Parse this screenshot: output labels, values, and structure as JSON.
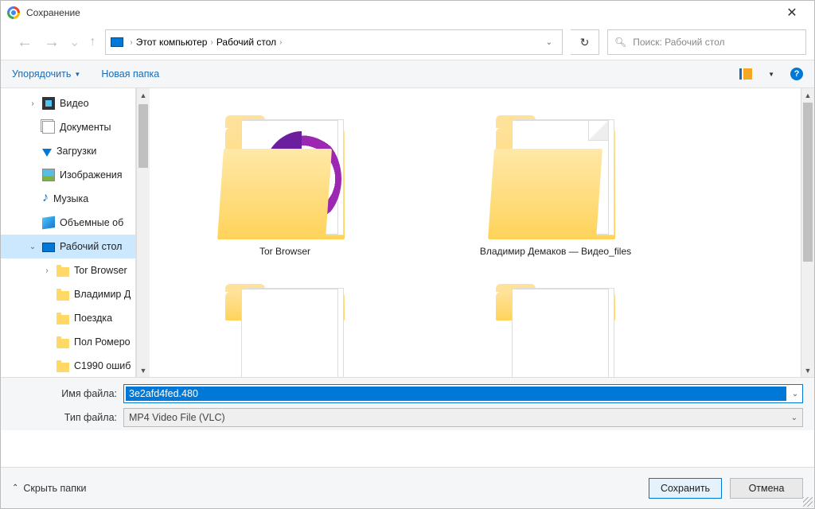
{
  "window": {
    "title": "Сохранение"
  },
  "nav": {
    "breadcrumb": {
      "root": "Этот компьютер",
      "current": "Рабочий стол"
    },
    "search_placeholder": "Поиск: Рабочий стол"
  },
  "toolbar": {
    "arrange": "Упорядочить",
    "new_folder": "Новая папка"
  },
  "sidebar": {
    "items": [
      {
        "label": "Видео",
        "icon": "video",
        "level": 2,
        "exp": ">"
      },
      {
        "label": "Документы",
        "icon": "docs",
        "level": 2
      },
      {
        "label": "Загрузки",
        "icon": "dl",
        "level": 2
      },
      {
        "label": "Изображения",
        "icon": "img",
        "level": 2
      },
      {
        "label": "Музыка",
        "icon": "music",
        "level": 2
      },
      {
        "label": "Объемные об",
        "icon": "box",
        "level": 2
      },
      {
        "label": "Рабочий стол",
        "icon": "desk",
        "level": 2,
        "exp": "v",
        "selected": true
      },
      {
        "label": "Tor Browser",
        "icon": "folder",
        "level": 3,
        "exp": ">"
      },
      {
        "label": "Владимир Д",
        "icon": "folder",
        "level": 3
      },
      {
        "label": "Поездка",
        "icon": "folder",
        "level": 3
      },
      {
        "label": "Пол Ромеро",
        "icon": "folder",
        "level": 3
      },
      {
        "label": "С1990 ошиб",
        "icon": "folder",
        "level": 3
      }
    ]
  },
  "content": {
    "items": [
      {
        "label": "Tor Browser",
        "kind": "tor-folder"
      },
      {
        "label": "Владимир Демаков — Видео_files",
        "kind": "doc-folder"
      },
      {
        "label": "",
        "kind": "partial"
      },
      {
        "label": "",
        "kind": "partial"
      }
    ]
  },
  "fields": {
    "filename_label": "Имя файла:",
    "filename_value": "3e2afd4fed.480",
    "filetype_label": "Тип файла:",
    "filetype_value": "MP4 Video File (VLC)"
  },
  "footer": {
    "hide_folders": "Скрыть папки",
    "save": "Сохранить",
    "cancel": "Отмена"
  }
}
